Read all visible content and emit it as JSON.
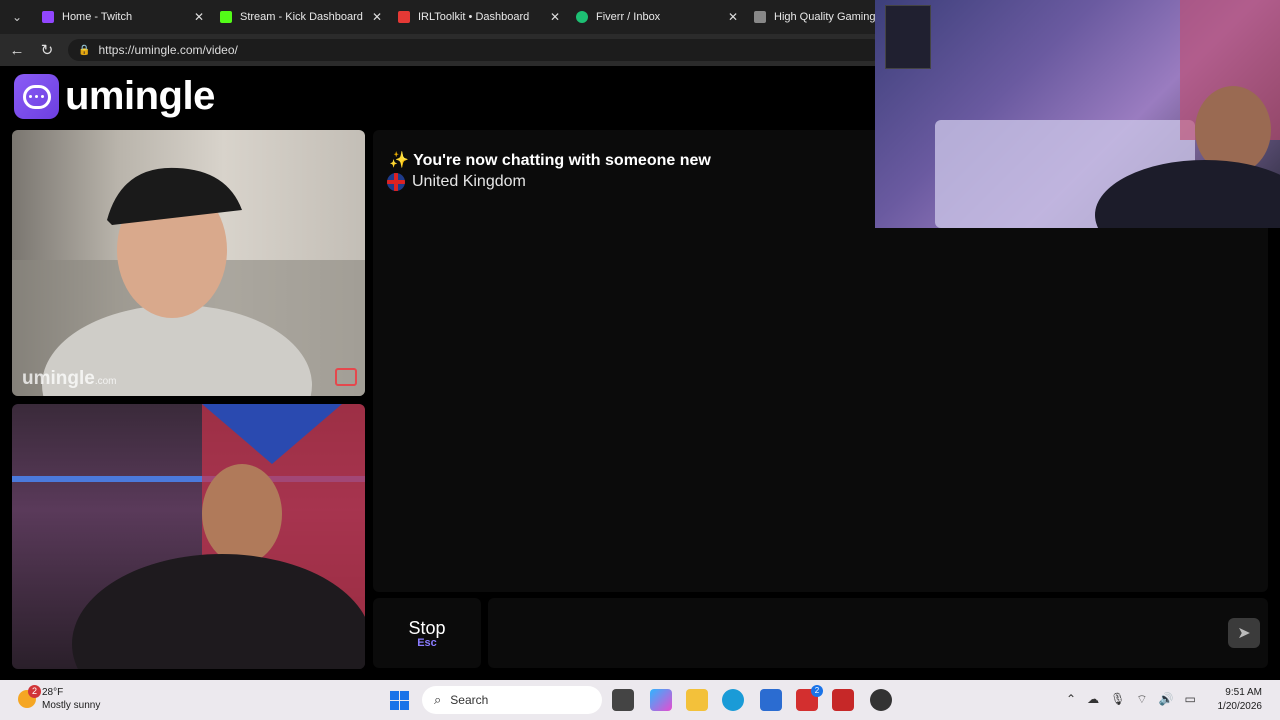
{
  "browser": {
    "tabs": [
      {
        "title": "Home - Twitch",
        "favicon_color": "#9146ff"
      },
      {
        "title": "Stream - Kick Dashboard",
        "favicon_color": "#53fc18"
      },
      {
        "title": "IRLToolkit • Dashboard",
        "favicon_color": "#e53935"
      },
      {
        "title": "Fiverr / Inbox",
        "favicon_color": "#1dbf73"
      },
      {
        "title": "High Quality Gaming Ge",
        "favicon_color": "#888888"
      }
    ],
    "url": "https://umingle.com/video/"
  },
  "site": {
    "logo_text": "umingle",
    "brand_color": "#7c4dff",
    "watermark": "umingle",
    "watermark_suffix": ".com"
  },
  "chat": {
    "status_message": "✨ You're now chatting with someone new",
    "country": "United Kingdom"
  },
  "controls": {
    "stop_label": "Stop",
    "stop_key": "Esc"
  },
  "taskbar": {
    "weather_temp": "28°F",
    "weather_desc": "Mostly sunny",
    "weather_badge": "2",
    "search_label": "Search",
    "notification_badge": "2",
    "time": "9:51 AM",
    "date": "1/20/2026"
  }
}
